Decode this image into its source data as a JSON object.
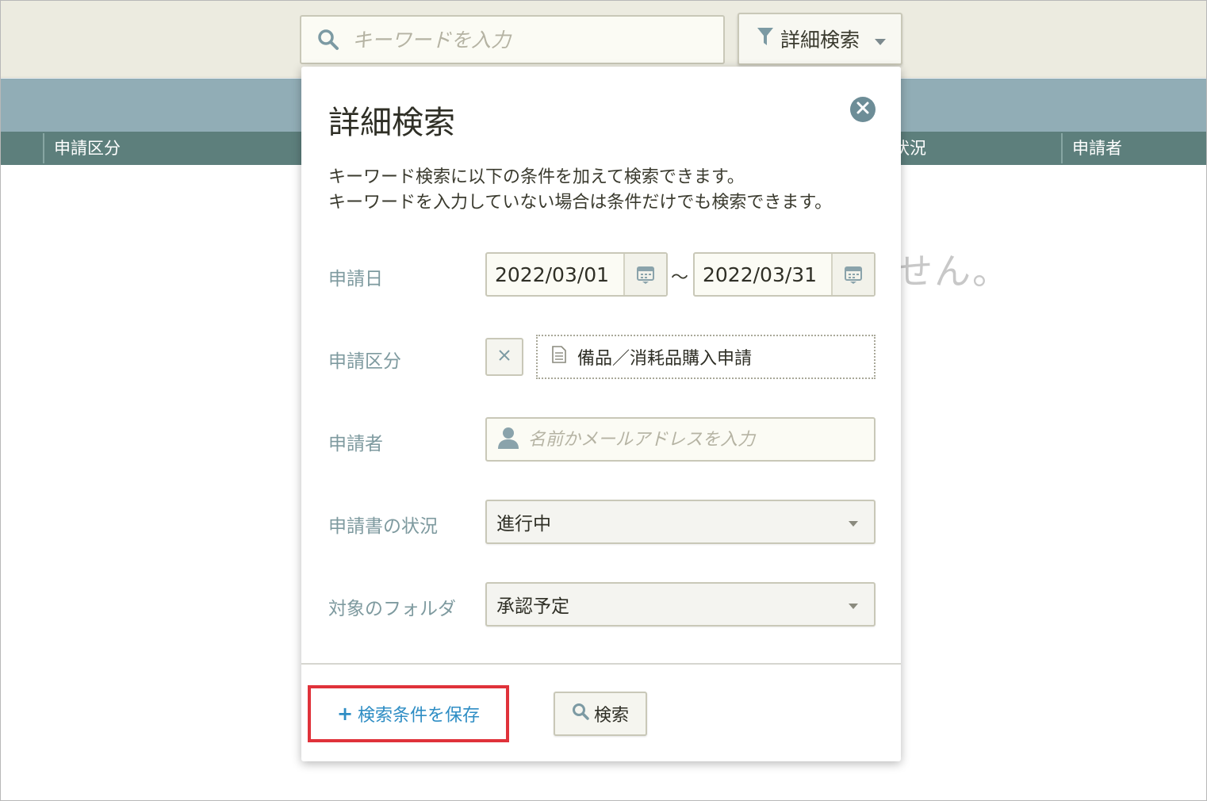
{
  "topbar": {
    "search_placeholder": "キーワードを入力",
    "advanced_label": "詳細検索"
  },
  "table": {
    "columns": [
      "申請区分",
      "状況",
      "申請者"
    ]
  },
  "empty_message": "せん。",
  "modal": {
    "title": "詳細検索",
    "description_line1": "キーワード検索に以下の条件を加えて検索できます。",
    "description_line2": "キーワードを入力していない場合は条件だけでも検索できます。",
    "fields": {
      "date_label": "申請日",
      "date_from": "2022/03/01",
      "date_to": "2022/03/31",
      "date_separator": "〜",
      "form_label": "申請区分",
      "form_value": "備品／消耗品購入申請",
      "applicant_label": "申請者",
      "applicant_placeholder": "名前かメールアドレスを入力",
      "status_label": "申請書の状況",
      "status_value": "進行中",
      "folder_label": "対象のフォルダ",
      "folder_value": "承認予定"
    },
    "save_condition_label": "検索条件を保存",
    "save_condition_plus": "+",
    "search_button_label": "検索"
  },
  "colors": {
    "accent_link": "#2e8dc4",
    "highlight_border": "#e0323a",
    "header_band": "#91adb6",
    "table_header": "#5d7f7c"
  }
}
